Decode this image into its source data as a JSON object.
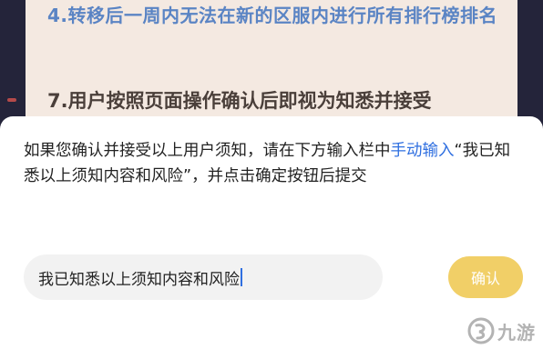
{
  "notice": {
    "item_4": "4.转移后一周内无法在新的区服内进行所有排行榜排名",
    "item_7": "7.用户按照页面操作确认后即视为知悉并接受"
  },
  "dialog": {
    "instruction_before": "如果您确认并接受以上用户须知，请在下方输入栏中",
    "instruction_link": "手动输入",
    "instruction_after": "“我已知悉以上须知内容和风险”，并点击确定按钮后提交",
    "input_value": "我已知悉以上须知内容和风险",
    "confirm_label": "确认"
  },
  "watermark": {
    "text": "九游",
    "icon": "jiuyou-logo-icon"
  },
  "colors": {
    "link": "#2f6fe0",
    "button": "#f1cf67",
    "notice_bg": "#f4e9e1",
    "notice_item_4": "#5a84c4",
    "backdrop": "#24243a"
  }
}
